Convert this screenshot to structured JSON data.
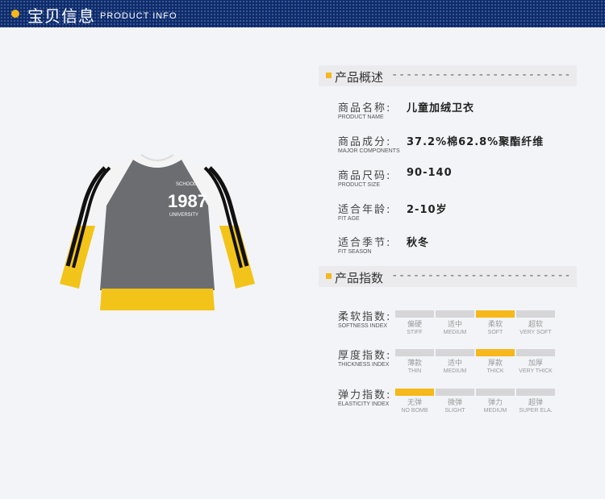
{
  "header": {
    "title_cn": "宝贝信息",
    "title_en": "PRODUCT INFO"
  },
  "garment": {
    "print_top": "SCHOOL",
    "print_number": "1987",
    "print_bottom": "UNIVERSITY"
  },
  "overview": {
    "title": "产品概述",
    "dashes": "-------------------------",
    "rows": [
      {
        "label_cn": "商品名称:",
        "label_en": "PRODUCT NAME",
        "value": "儿童加绒卫衣"
      },
      {
        "label_cn": "商品成分:",
        "label_en": "MAJOR COMPONENTS",
        "value": "37.2%棉62.8%聚酯纤维"
      },
      {
        "label_cn": "商品尺码:",
        "label_en": "PRODUCT SIZE",
        "value": "90-140"
      },
      {
        "label_cn": "适合年龄:",
        "label_en": "FIT AGE",
        "value": "2-10岁"
      },
      {
        "label_cn": "适合季节:",
        "label_en": "FIT SEASON",
        "value": "秋冬"
      }
    ]
  },
  "indices": {
    "title": "产品指数",
    "dashes": "-------------------------",
    "rows": [
      {
        "label_cn": "柔软指数:",
        "label_en": "SOFTNESS INDEX",
        "active_index": 2,
        "levels": [
          {
            "cn": "偏硬",
            "en": "STIFF"
          },
          {
            "cn": "适中",
            "en": "MEDIUM"
          },
          {
            "cn": "柔软",
            "en": "SOFT"
          },
          {
            "cn": "超软",
            "en": "VERY SOFT"
          }
        ]
      },
      {
        "label_cn": "厚度指数:",
        "label_en": "THICKNESS INDEX",
        "active_index": 2,
        "levels": [
          {
            "cn": "薄款",
            "en": "THIN"
          },
          {
            "cn": "适中",
            "en": "MEDIUM"
          },
          {
            "cn": "厚款",
            "en": "THICK"
          },
          {
            "cn": "加厚",
            "en": "VERY THICK"
          }
        ]
      },
      {
        "label_cn": "弹力指数:",
        "label_en": "ELASTICITY INDEX",
        "active_index": 0,
        "levels": [
          {
            "cn": "无弹",
            "en": "NO BOMB"
          },
          {
            "cn": "微弹",
            "en": "SLIGHT"
          },
          {
            "cn": "弹力",
            "en": "MEDIUM"
          },
          {
            "cn": "超弹",
            "en": "SUPER ELA."
          }
        ]
      }
    ]
  },
  "colors": {
    "header_bg": "#0d2c6e",
    "accent": "#f6b81a",
    "bar_inactive": "#d6d6d9",
    "garment_gray": "#6b6d71",
    "garment_yellow": "#f2c419"
  }
}
